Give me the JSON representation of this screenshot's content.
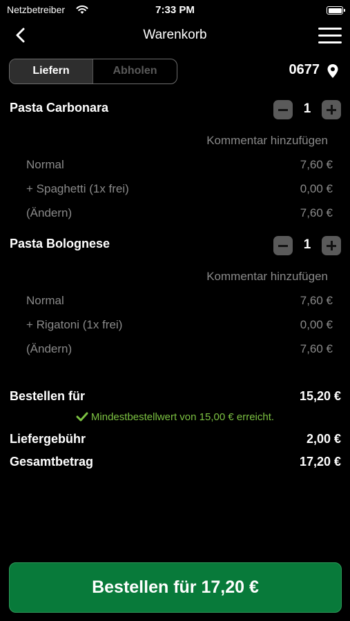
{
  "status_bar": {
    "carrier": "Netzbetreiber",
    "time": "7:33 PM"
  },
  "nav": {
    "title": "Warenkorb",
    "back_icon": "chevron-left-icon",
    "menu_icon": "hamburger-menu-icon"
  },
  "delivery_toggle": {
    "options": [
      "Liefern",
      "Abholen"
    ],
    "selected": "Liefern"
  },
  "store": {
    "code": "0677",
    "icon": "location-pin-icon"
  },
  "cart": {
    "items": [
      {
        "name": "Pasta Carbonara",
        "quantity": "1",
        "comment_label": "Kommentar hinzufügen",
        "lines": [
          {
            "label": "Normal",
            "price": "7,60 €"
          },
          {
            "label": "+ Spaghetti (1x frei)",
            "price": "0,00 €"
          },
          {
            "label": "(Ändern)",
            "price": "7,60 €"
          }
        ]
      },
      {
        "name": "Pasta Bolognese",
        "quantity": "1",
        "comment_label": "Kommentar hinzufügen",
        "lines": [
          {
            "label": "Normal",
            "price": "7,60 €"
          },
          {
            "label": "+ Rigatoni (1x frei)",
            "price": "0,00 €"
          },
          {
            "label": "(Ändern)",
            "price": "7,60 €"
          }
        ]
      }
    ]
  },
  "totals": {
    "subtotal_label": "Bestellen für",
    "subtotal_value": "15,20 €",
    "minimum_message": "Mindestbestellwert von 15,00 € erreicht.",
    "delivery_fee_label": "Liefergebühr",
    "delivery_fee_value": "2,00 €",
    "grand_total_label": "Gesamtbetrag",
    "grand_total_value": "17,20 €"
  },
  "order_button": {
    "label": "Bestellen für 17,20 €"
  },
  "colors": {
    "accent_green": "#087a3a",
    "success_text": "#7cc242",
    "muted_text": "#8a8a8a"
  }
}
